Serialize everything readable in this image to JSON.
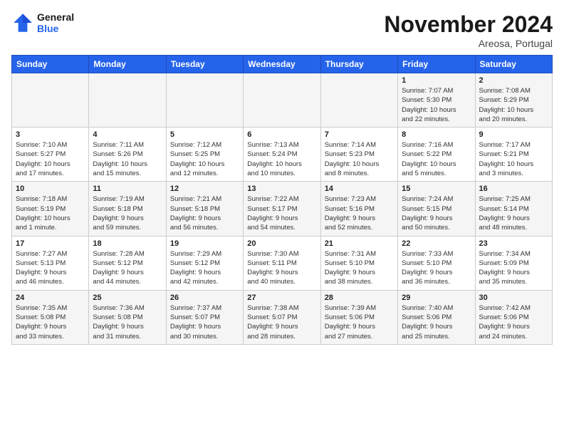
{
  "logo": {
    "line1": "General",
    "line2": "Blue"
  },
  "title": "November 2024",
  "location": "Areosa, Portugal",
  "days_of_week": [
    "Sunday",
    "Monday",
    "Tuesday",
    "Wednesday",
    "Thursday",
    "Friday",
    "Saturday"
  ],
  "weeks": [
    [
      {
        "day": "",
        "info": ""
      },
      {
        "day": "",
        "info": ""
      },
      {
        "day": "",
        "info": ""
      },
      {
        "day": "",
        "info": ""
      },
      {
        "day": "",
        "info": ""
      },
      {
        "day": "1",
        "info": "Sunrise: 7:07 AM\nSunset: 5:30 PM\nDaylight: 10 hours\nand 22 minutes."
      },
      {
        "day": "2",
        "info": "Sunrise: 7:08 AM\nSunset: 5:29 PM\nDaylight: 10 hours\nand 20 minutes."
      }
    ],
    [
      {
        "day": "3",
        "info": "Sunrise: 7:10 AM\nSunset: 5:27 PM\nDaylight: 10 hours\nand 17 minutes."
      },
      {
        "day": "4",
        "info": "Sunrise: 7:11 AM\nSunset: 5:26 PM\nDaylight: 10 hours\nand 15 minutes."
      },
      {
        "day": "5",
        "info": "Sunrise: 7:12 AM\nSunset: 5:25 PM\nDaylight: 10 hours\nand 12 minutes."
      },
      {
        "day": "6",
        "info": "Sunrise: 7:13 AM\nSunset: 5:24 PM\nDaylight: 10 hours\nand 10 minutes."
      },
      {
        "day": "7",
        "info": "Sunrise: 7:14 AM\nSunset: 5:23 PM\nDaylight: 10 hours\nand 8 minutes."
      },
      {
        "day": "8",
        "info": "Sunrise: 7:16 AM\nSunset: 5:22 PM\nDaylight: 10 hours\nand 5 minutes."
      },
      {
        "day": "9",
        "info": "Sunrise: 7:17 AM\nSunset: 5:21 PM\nDaylight: 10 hours\nand 3 minutes."
      }
    ],
    [
      {
        "day": "10",
        "info": "Sunrise: 7:18 AM\nSunset: 5:19 PM\nDaylight: 10 hours\nand 1 minute."
      },
      {
        "day": "11",
        "info": "Sunrise: 7:19 AM\nSunset: 5:18 PM\nDaylight: 9 hours\nand 59 minutes."
      },
      {
        "day": "12",
        "info": "Sunrise: 7:21 AM\nSunset: 5:18 PM\nDaylight: 9 hours\nand 56 minutes."
      },
      {
        "day": "13",
        "info": "Sunrise: 7:22 AM\nSunset: 5:17 PM\nDaylight: 9 hours\nand 54 minutes."
      },
      {
        "day": "14",
        "info": "Sunrise: 7:23 AM\nSunset: 5:16 PM\nDaylight: 9 hours\nand 52 minutes."
      },
      {
        "day": "15",
        "info": "Sunrise: 7:24 AM\nSunset: 5:15 PM\nDaylight: 9 hours\nand 50 minutes."
      },
      {
        "day": "16",
        "info": "Sunrise: 7:25 AM\nSunset: 5:14 PM\nDaylight: 9 hours\nand 48 minutes."
      }
    ],
    [
      {
        "day": "17",
        "info": "Sunrise: 7:27 AM\nSunset: 5:13 PM\nDaylight: 9 hours\nand 46 minutes."
      },
      {
        "day": "18",
        "info": "Sunrise: 7:28 AM\nSunset: 5:12 PM\nDaylight: 9 hours\nand 44 minutes."
      },
      {
        "day": "19",
        "info": "Sunrise: 7:29 AM\nSunset: 5:12 PM\nDaylight: 9 hours\nand 42 minutes."
      },
      {
        "day": "20",
        "info": "Sunrise: 7:30 AM\nSunset: 5:11 PM\nDaylight: 9 hours\nand 40 minutes."
      },
      {
        "day": "21",
        "info": "Sunrise: 7:31 AM\nSunset: 5:10 PM\nDaylight: 9 hours\nand 38 minutes."
      },
      {
        "day": "22",
        "info": "Sunrise: 7:33 AM\nSunset: 5:10 PM\nDaylight: 9 hours\nand 36 minutes."
      },
      {
        "day": "23",
        "info": "Sunrise: 7:34 AM\nSunset: 5:09 PM\nDaylight: 9 hours\nand 35 minutes."
      }
    ],
    [
      {
        "day": "24",
        "info": "Sunrise: 7:35 AM\nSunset: 5:08 PM\nDaylight: 9 hours\nand 33 minutes."
      },
      {
        "day": "25",
        "info": "Sunrise: 7:36 AM\nSunset: 5:08 PM\nDaylight: 9 hours\nand 31 minutes."
      },
      {
        "day": "26",
        "info": "Sunrise: 7:37 AM\nSunset: 5:07 PM\nDaylight: 9 hours\nand 30 minutes."
      },
      {
        "day": "27",
        "info": "Sunrise: 7:38 AM\nSunset: 5:07 PM\nDaylight: 9 hours\nand 28 minutes."
      },
      {
        "day": "28",
        "info": "Sunrise: 7:39 AM\nSunset: 5:06 PM\nDaylight: 9 hours\nand 27 minutes."
      },
      {
        "day": "29",
        "info": "Sunrise: 7:40 AM\nSunset: 5:06 PM\nDaylight: 9 hours\nand 25 minutes."
      },
      {
        "day": "30",
        "info": "Sunrise: 7:42 AM\nSunset: 5:06 PM\nDaylight: 9 hours\nand 24 minutes."
      }
    ]
  ]
}
